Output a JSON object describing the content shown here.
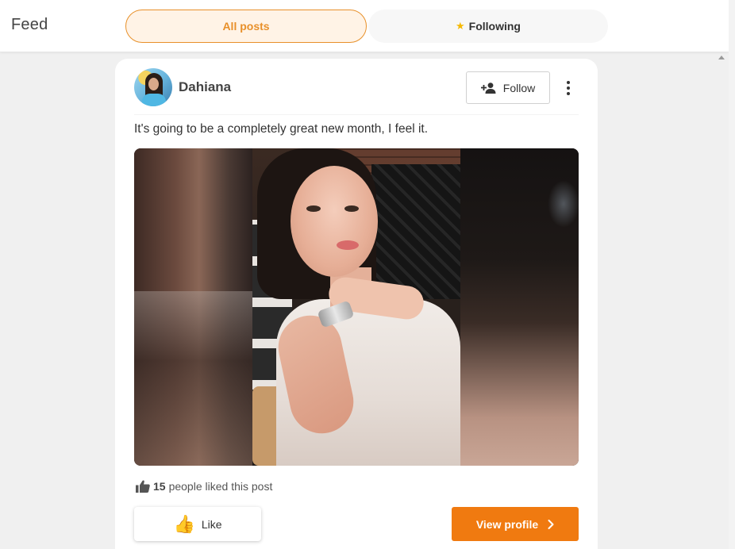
{
  "header": {
    "title": "Feed",
    "tabs": [
      {
        "label": "All posts",
        "active": true
      },
      {
        "label": "Following",
        "icon": "star-icon",
        "active": false
      }
    ]
  },
  "post": {
    "author": "Dahiana",
    "avatar_icon": "avatar",
    "follow_label": "Follow",
    "text": "It's going to be a completely great new month, I feel it.",
    "likes": {
      "count": "15",
      "suffix": "people liked this post"
    },
    "like_label": "Like",
    "view_profile_label": "View profile"
  },
  "colors": {
    "accent": "#f07a10",
    "tab_active_border": "#e8902a",
    "tab_active_bg": "#fff3e6",
    "star": "#f5b800"
  }
}
